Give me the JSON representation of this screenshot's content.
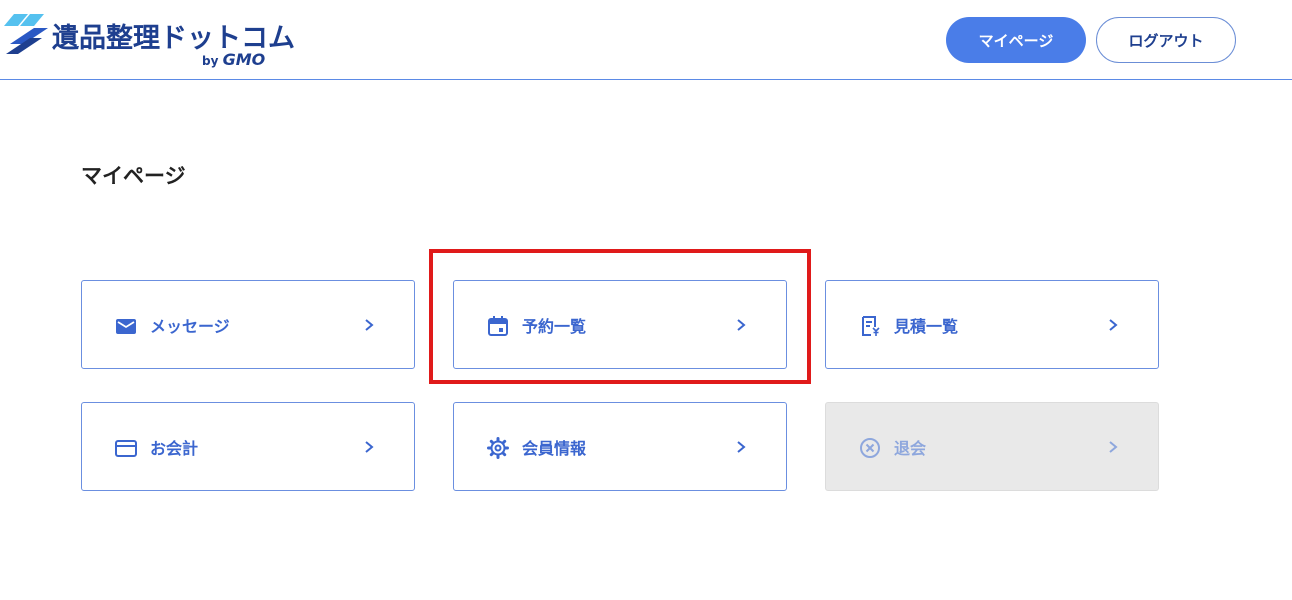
{
  "header": {
    "logo_text": "遺品整理ドットコム",
    "logo_by": "by",
    "logo_gmo": "GMO",
    "mypage_button": "マイページ",
    "logout_button": "ログアウト"
  },
  "main": {
    "title": "マイページ",
    "cards": [
      {
        "label": "メッセージ",
        "icon": "mail-icon",
        "enabled": true
      },
      {
        "label": "予約一覧",
        "icon": "calendar-icon",
        "enabled": true
      },
      {
        "label": "見積一覧",
        "icon": "receipt-icon",
        "enabled": true
      },
      {
        "label": "お会計",
        "icon": "credit-card-icon",
        "enabled": true
      },
      {
        "label": "会員情報",
        "icon": "gear-icon",
        "enabled": true
      },
      {
        "label": "退会",
        "icon": "circle-x-icon",
        "enabled": false
      }
    ]
  },
  "colors": {
    "accent": "#4a7de8",
    "brand": "#1e3f8f",
    "highlight": "#e01a1a",
    "disabled_bg": "#e9e9e9"
  }
}
